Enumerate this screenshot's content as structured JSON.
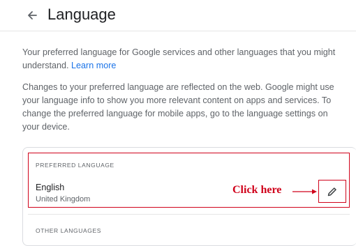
{
  "header": {
    "back_icon": "arrow-left-icon",
    "title": "Language"
  },
  "intro": {
    "text": "Your preferred language for Google services and other languages that you might understand.",
    "link": "Learn more"
  },
  "changes": {
    "text": "Changes to your preferred language are reflected on the web. Google might use your language info to show you more relevant content on apps and services. To change the preferred language for mobile apps, go to the language settings on your device."
  },
  "preferred": {
    "label": "PREFERRED LANGUAGE",
    "language": "English",
    "region": "United Kingdom",
    "edit_icon": "pencil-icon"
  },
  "annotation": {
    "text": "Click here",
    "color": "#d0021b"
  },
  "other": {
    "label": "OTHER LANGUAGES"
  },
  "colors": {
    "link": "#1a73e8",
    "text": "#202124",
    "secondary": "#5f6368",
    "annotation": "#d0021b"
  }
}
